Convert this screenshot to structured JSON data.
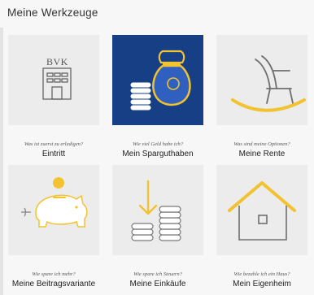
{
  "section_title": "Meine Werkzeuge",
  "tools": [
    {
      "question": "Was ist zuerst zu erledigen?",
      "label": "Eintritt",
      "icon": "bvk-building-icon",
      "logo_text": "BVK"
    },
    {
      "question": "Wie viel Geld habe ich?",
      "label": "Mein Sparguthaben",
      "icon": "money-bag-coins-icon"
    },
    {
      "question": "Was sind meine Optionen?",
      "label": "Meine Rente",
      "icon": "rocking-chair-icon"
    },
    {
      "question": "Wie spare ich mehr?",
      "label": "Meine Beitragsvariante",
      "icon": "piggy-bank-icon"
    },
    {
      "question": "Wie spare ich Steuern?",
      "label": "Meine Einkäufe",
      "icon": "coins-arrow-icon"
    },
    {
      "question": "Wie bezahle ich ein Haus?",
      "label": "Mein Eigenheim",
      "icon": "house-icon"
    }
  ],
  "colors": {
    "accent_yellow": "#f2c230",
    "active_tile_bg": "#173f86",
    "tile_bg": "#ececec",
    "line_gray": "#6e6e6e"
  }
}
